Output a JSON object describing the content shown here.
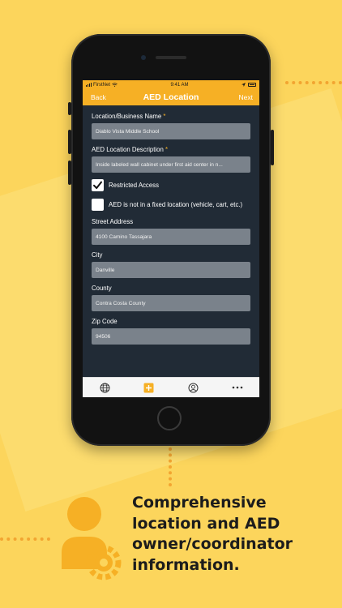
{
  "status_bar": {
    "carrier": "FirstNet",
    "time": "9:41 AM"
  },
  "nav": {
    "back": "Back",
    "title": "AED Location",
    "next": "Next"
  },
  "form": {
    "business_name": {
      "label": "Location/Business Name",
      "required": "*",
      "value": "Diablo Vista Middle School"
    },
    "description": {
      "label": "AED Location Description",
      "required": "*",
      "value": "Inside labeled wall cabinet under first aid center in n..."
    },
    "restricted": {
      "label": "Restricted Access",
      "checked": true
    },
    "not_fixed": {
      "label": "AED is not in a fixed location (vehicle, cart, etc.)",
      "checked": false
    },
    "street": {
      "label": "Street Address",
      "value": "4100 Camino Tassajara"
    },
    "city": {
      "label": "City",
      "value": "Danville"
    },
    "county": {
      "label": "County",
      "value": "Contra Costa County"
    },
    "zip": {
      "label": "Zip Code",
      "value": "94506"
    }
  },
  "tabs": [
    {
      "icon": "globe-icon"
    },
    {
      "icon": "add-icon"
    },
    {
      "icon": "user-circle-icon"
    },
    {
      "icon": "more-icon"
    }
  ],
  "tagline": [
    "Comprehensive",
    "location and AED",
    "owner/coordinator",
    "information."
  ],
  "colors": {
    "accent": "#F6B025",
    "background": "#FCD55C",
    "screen": "#212B36",
    "field": "#7A828B"
  }
}
